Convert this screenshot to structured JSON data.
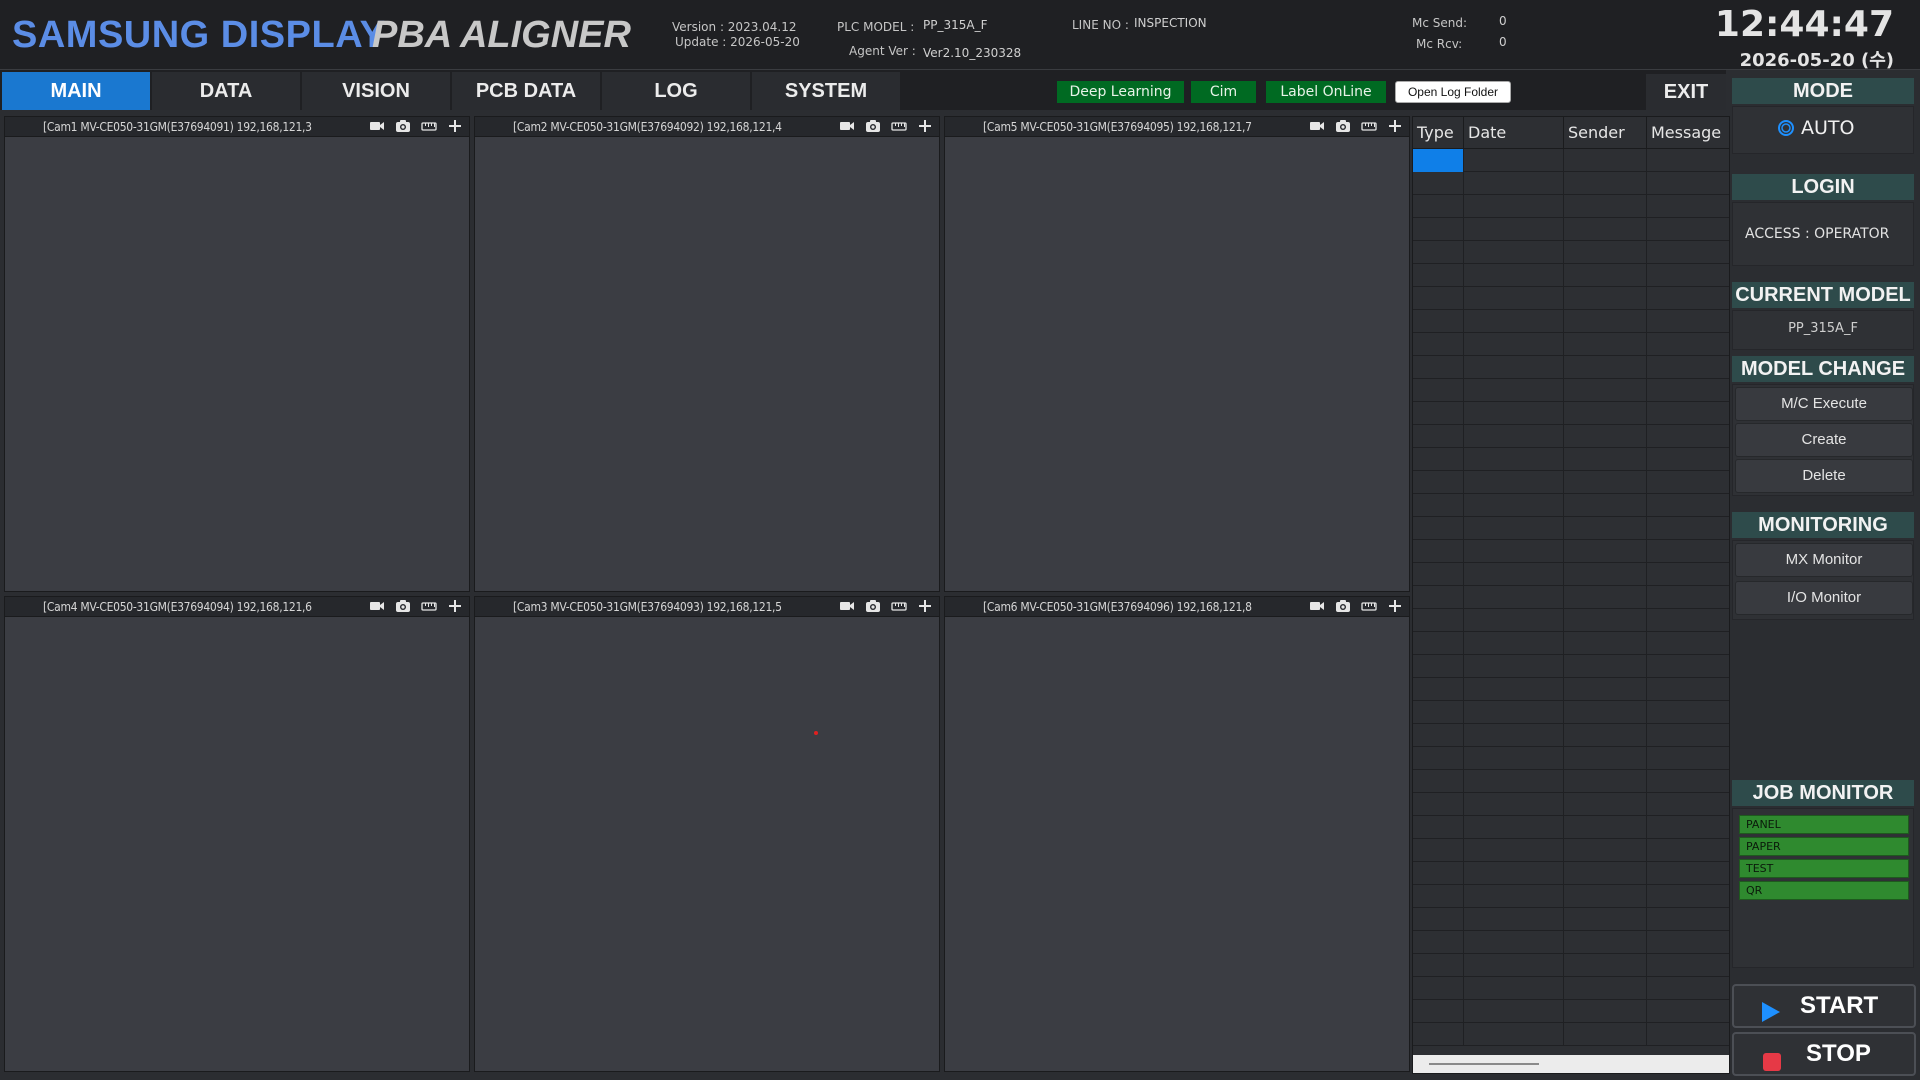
{
  "header": {
    "brand": "SAMSUNG DISPLAY",
    "product": "PBA ALIGNER",
    "version": "Version : 2023.04.12",
    "update": "Update : 2026-05-20",
    "plc_model_label": "PLC MODEL :",
    "plc_model_value": "PP_315A_F",
    "agent_ver_label": "Agent Ver :",
    "agent_ver_value": "Ver2.10_230328",
    "line_no_label": "LINE NO :",
    "line_no_value": "INSPECTION",
    "mc_send_label": "Mc Send:",
    "mc_send_value": "0",
    "mc_rcv_label": "Mc Rcv:",
    "mc_rcv_value": "0",
    "time": "12:44:47",
    "date": "2026-05-20 (수)"
  },
  "tabs": [
    "MAIN",
    "DATA",
    "VISION",
    "PCB DATA",
    "LOG",
    "SYSTEM"
  ],
  "status": {
    "deep_learning": "Deep Learning",
    "cim": "Cim",
    "label_online": "Label OnLine",
    "open_log_folder": "Open Log Folder",
    "exit": "EXIT"
  },
  "cameras": [
    {
      "title": "[Cam1 MV-CE050-31GM(E37694091) 192,168,121,3"
    },
    {
      "title": "[Cam2 MV-CE050-31GM(E37694092) 192,168,121,4"
    },
    {
      "title": "[Cam5 MV-CE050-31GM(E37694095) 192,168,121,7"
    },
    {
      "title": "[Cam4 MV-CE050-31GM(E37694094) 192,168,121,6"
    },
    {
      "title": "[Cam3 MV-CE050-31GM(E37694093) 192,168,121,5"
    },
    {
      "title": "[Cam6 MV-CE050-31GM(E37694096) 192,168,121,8"
    }
  ],
  "log_table": {
    "columns": [
      "Type",
      "Date",
      "Sender",
      "Message"
    ],
    "rows": []
  },
  "right_panel": {
    "mode_title": "MODE",
    "mode_value": "AUTO",
    "login_title": "LOGIN",
    "access": "ACCESS : OPERATOR",
    "current_model_title": "CURRENT MODEL",
    "current_model_value": "PP_315A_F",
    "model_change_title": "MODEL CHANGE",
    "mc_execute": "M/C Execute",
    "create": "Create",
    "delete": "Delete",
    "monitoring_title": "MONITORING",
    "mx_monitor": "MX Monitor",
    "io_monitor": "I/O Monitor",
    "job_monitor_title": "JOB MONITOR",
    "jobs": [
      "PANEL",
      "PAPER",
      "TEST",
      "QR"
    ],
    "start": "START",
    "stop": "STOP"
  },
  "colors": {
    "brand": "#5b8de6",
    "active_tab": "#1a78d0",
    "status_green": "#006a22",
    "section_head": "#2e4b4b",
    "job_green": "#2f8a2f",
    "start_icon": "#1e90ff",
    "stop_icon": "#e63946"
  },
  "icons": [
    "video-camera-icon",
    "snapshot-camera-icon",
    "ruler-icon",
    "crosshair-plus-icon",
    "radio-icon",
    "play-icon",
    "stop-icon"
  ]
}
